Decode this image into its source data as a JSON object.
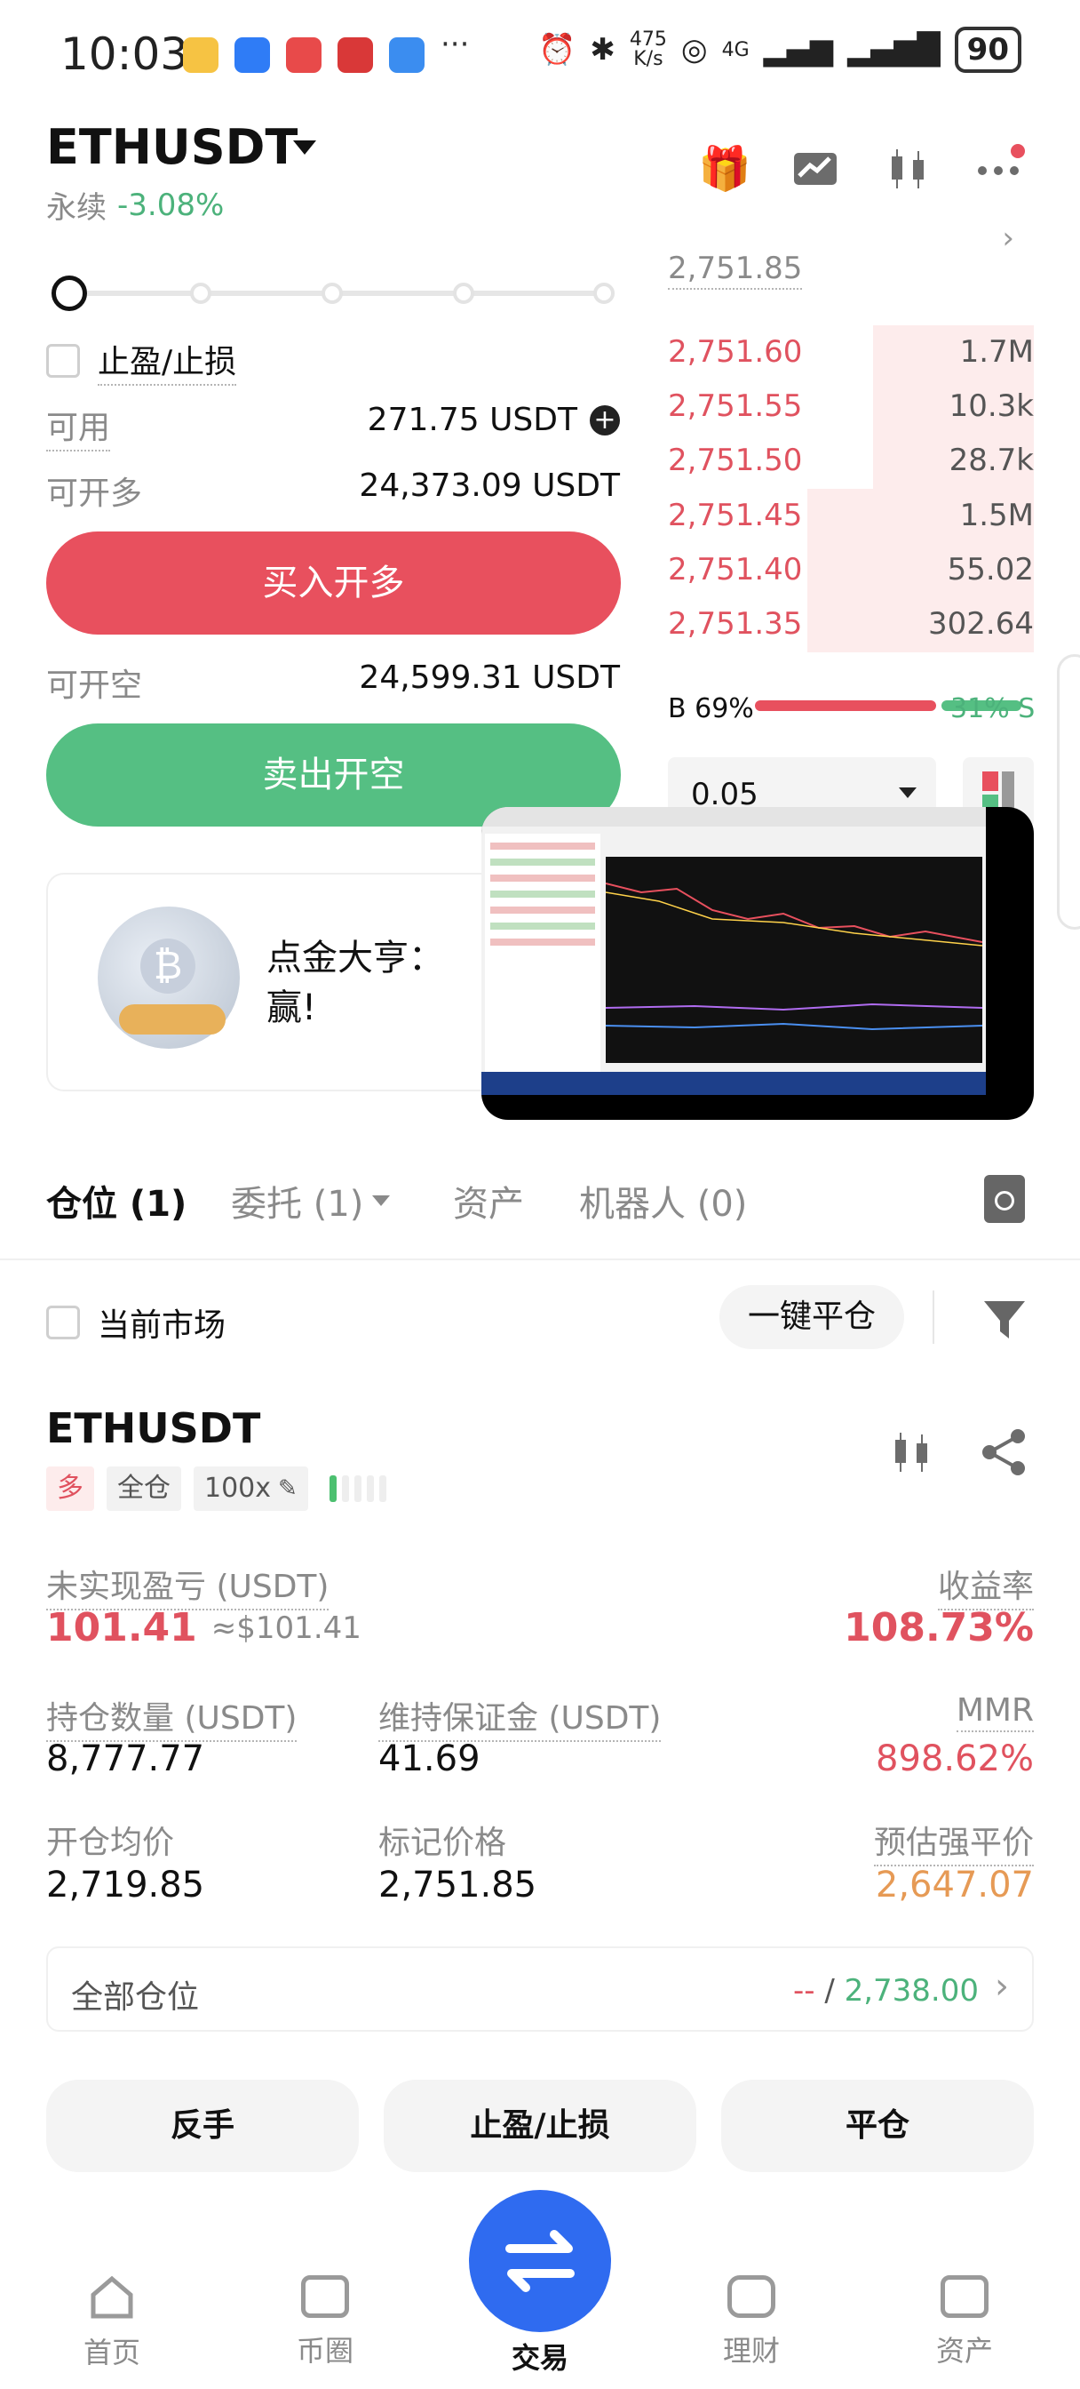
{
  "status_bar": {
    "time": "10:03",
    "net_speed_value": "475",
    "net_speed_unit": "K/s",
    "signal_label": "4G",
    "battery": "90"
  },
  "header": {
    "pair": "ETHUSDT",
    "contract_type": "永续",
    "change": "-3.08%"
  },
  "order_form": {
    "tp_sl_label": "止盈/止损",
    "available_label": "可用",
    "available_value": "271.75 USDT",
    "max_long_label": "可开多",
    "max_long_value": "24,373.09 USDT",
    "buy_button": "买入开多",
    "max_short_label": "可开空",
    "max_short_value": "24,599.31 USDT",
    "sell_button": "卖出开空"
  },
  "order_book": {
    "last_price": "2,751.85",
    "asks": [
      {
        "price": "2,751.60",
        "size": "1.7M",
        "depth": 0.44
      },
      {
        "price": "2,751.55",
        "size": "10.3k",
        "depth": 0.44
      },
      {
        "price": "2,751.50",
        "size": "28.7k",
        "depth": 0.44
      },
      {
        "price": "2,751.45",
        "size": "1.5M",
        "depth": 0.62
      },
      {
        "price": "2,751.40",
        "size": "55.02",
        "depth": 0.62
      },
      {
        "price": "2,751.35",
        "size": "302.64",
        "depth": 0.62
      }
    ],
    "buy_ratio": "B 69%",
    "sell_ratio": "31% S",
    "buy_fraction": 0.69,
    "depth_step": "0.05"
  },
  "banner": {
    "text_line1": "点金大亨：",
    "text_line2": "赢!"
  },
  "tabs": [
    {
      "label": "仓位 (1)"
    },
    {
      "label": "委托 (1)"
    },
    {
      "label": "资产"
    },
    {
      "label": "机器人 (0)"
    }
  ],
  "filters": {
    "current_market": "当前市场",
    "close_all": "一键平仓"
  },
  "position": {
    "symbol": "ETHUSDT",
    "side_tag": "多",
    "margin_tag": "全仓",
    "leverage_tag": "100x",
    "unrealized_pnl_label": "未实现盈亏 (USDT)",
    "unrealized_pnl": "101.41",
    "unrealized_pnl_usd": "≈$101.41",
    "roi_label": "收益率",
    "roi": "108.73%",
    "size_label": "持仓数量 (USDT)",
    "size": "8,777.77",
    "maint_margin_label": "维持保证金 (USDT)",
    "maint_margin": "41.69",
    "mmr_label": "MMR",
    "mmr": "898.62%",
    "entry_price_label": "开仓均价",
    "entry_price": "2,719.85",
    "mark_price_label": "标记价格",
    "mark_price": "2,751.85",
    "liq_price_label": "预估强平价",
    "liq_price": "2,647.07",
    "all_positions_label": "全部仓位",
    "all_positions_left": "--",
    "all_positions_sep": " / ",
    "all_positions_right": "2,738.00",
    "reverse_button": "反手",
    "tpsl_button": "止盈/止损",
    "close_button": "平仓"
  },
  "bottom_nav": [
    {
      "label": "首页"
    },
    {
      "label": "币圈"
    },
    {
      "label": "交易"
    },
    {
      "label": "理财"
    },
    {
      "label": "资产"
    }
  ],
  "colors": {
    "buy": "#e8505e",
    "sell": "#55bf83",
    "accent_blue": "#2f6bf0"
  }
}
